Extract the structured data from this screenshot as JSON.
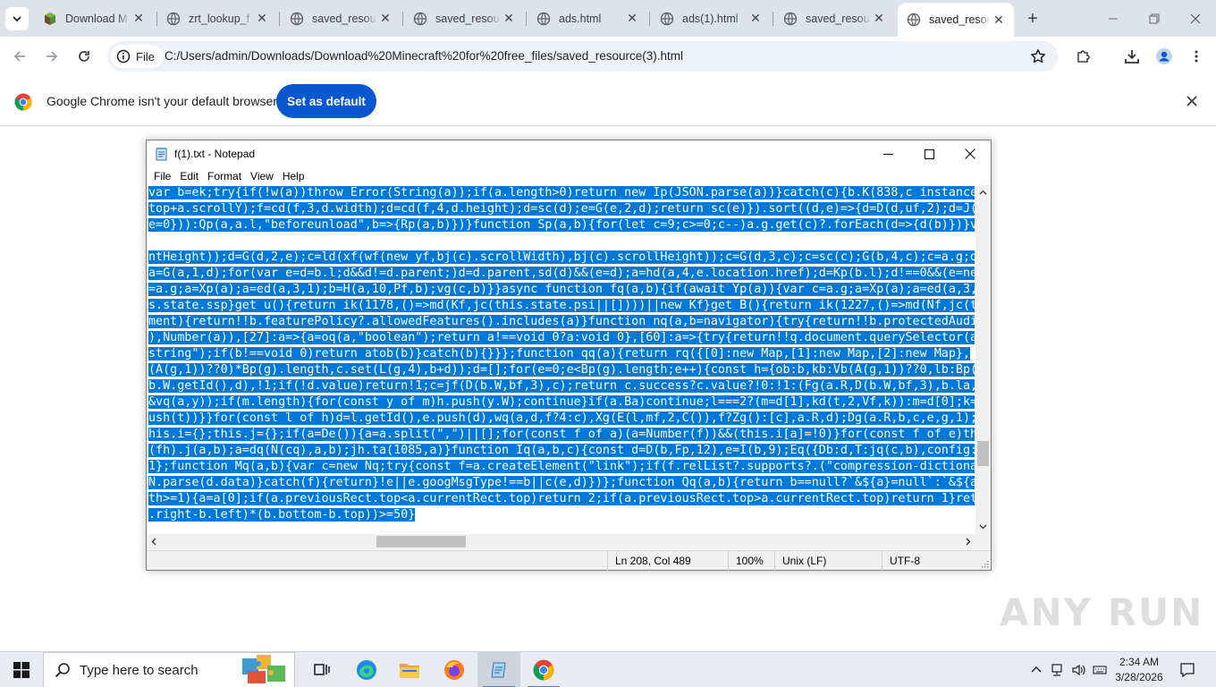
{
  "browser": {
    "tabs": [
      {
        "title": "Download M",
        "favicon": "minecraft-cube-icon"
      },
      {
        "title": "zrt_lookup_f",
        "favicon": "globe-icon"
      },
      {
        "title": "saved_resou",
        "favicon": "globe-icon"
      },
      {
        "title": "saved_resou",
        "favicon": "globe-icon"
      },
      {
        "title": "ads.html",
        "favicon": "globe-icon"
      },
      {
        "title": "ads(1).html",
        "favicon": "globe-icon"
      },
      {
        "title": "saved_resou",
        "favicon": "globe-icon"
      },
      {
        "title": "saved_resou",
        "favicon": "globe-icon",
        "active": true
      }
    ],
    "address": {
      "chip_label": "File",
      "url": "C:/Users/admin/Downloads/Download%20Minecraft%20for%20free_files/saved_resource(3).html"
    },
    "infobar": {
      "message": "Google Chrome isn't your default browser",
      "button_label": "Set as default"
    },
    "accent_color": "#0b57d0"
  },
  "notepad": {
    "title": "f(1).txt - Notepad",
    "menu": [
      "File",
      "Edit",
      "Format",
      "View",
      "Help"
    ],
    "lines": [
      "var b=ek;try{if(!w(a))throw Error(String(a));if(a.length>0)return new Ip(JSON.parse(a))}catch(c){b.K(838,c instance",
      "top+a.scrollY);f=cd(f,3,d.width);d=cd(f,4,d.height);d=sc(d);e=G(e,2,d);return sc(e)}).sort((d,e)=>{d=D(d,uf,2);d=J(",
      "e=0})):Qp(a,a.l,\"beforeunload\",b=>{Rp(a,b)})}function Sp(a,b){for(let c=9;c>=0;c--)a.g.get(c)?.forEach(d=>{d(b)})}v",
      "",
      "ntHeight));d=G(d,2,e);c=ld(xf(wf(new yf,bj(c).scrollWidth),bj(c).scrollHeight));c=G(d,3,c);c=sc(c);G(b,4,c);c=a.g;d",
      "a=G(a,1,d);for(var e=d=b.l;d&&d!=d.parent;)d=d.parent,sd(d)&&(e=d);a=hd(a,4,e.location.href);d=Kp(b.l);d!==0&&(e=ne",
      "=a.g;a=Xp(a);a=ed(a,3,1);b=H(a,10,Pf,b);vg(c,b)}}async function fq(a,b){if(await Yp(a)){var c=a.g;a=Xp(a);a=ed(a,3,",
      "s.state.ssp}get u(){return ik(1178,()=>md(Kf,jc(this.state.psi||[])))||new Kf}get B(){return ik(1227,()=>md(Nf,jc(t",
      "ment){return!!b.featurePolicy?.allowedFeatures().includes(a)}function nq(a,b=navigator){try{return!!b.protectedAudi",
      "),Number(a)),[27]:a=>{a=oq(a,\"boolean\");return a!==void 0?a:void 0},[60]:a=>{try{return!!q.document.querySelector(a",
      "string\");if(b!==void 0)return atob(b)}catch(b){}}};function qq(a){return rq({[0]:new Map,[1]:new Map,[2]:new Map},",
      "(A(g,1))??0)*Bp(g).length,c.set(L(g,4),b+d));d=[];for(e=0;e<Bp(g).length;e++){const h={ob:b,kb:Vb(A(g,1))??0,lb:Bp(",
      "b.W.getId(),d),!1;if(!d.value)return!1;c=jf(D(b.W,bf,3),c);return c.success?c.value?!0:!1:(Fg(a.R,D(b.W,bf,3),b.la,",
      "&vq(a,y));if(m.length){for(const y of m)h.push(y.W);continue}if(a.Ba)continue;l===2?(m=d[1],kd(t,2,Vf,k)):m=d[0];k=",
      "ush(t))}}for(const l of h)d=l.getId(),e.push(d),wq(a,d,f?4:c),Xg(E(l,mf,2,C()),f?Zg():[c],a.R,d);Dg(a.R,b,c,e,g,1);",
      "his.i={};this.j={};if(a=De()){a=a.split(\",\")||[];for(const f of a)(a=Number(f))&&(this.i[a]=!0)}for(const f of e)th",
      "(fh).j(a,b);a=dq(N(cq),a,b);jh.ta(1085,a)}function Iq(a,b,c){const d=D(b,Fp,12),e=I(b,9);Eq({Db:d,T:jq(c,b),config:",
      "1};function Mq(a,b){var c=new Nq;try{const f=a.createElement(\"link\");if(f.relList?.supports?.(\"compression-dictiona",
      "N.parse(d.data)}catch(f){return}!e||e.googMsgType!==b||c(e,d)})};function Qq(a,b){return b==null?`&${a}=null`:`&${a",
      "th>=1){a=a[0];if(a.previousRect.top<a.currentRect.top)return 2;if(a.previousRect.top>a.currentRect.top)return 1}ret",
      ".right-b.left)*(b.bottom-b.top))>=50}"
    ],
    "status": {
      "position": "Ln 208, Col 489",
      "zoom": "100%",
      "line_ending": "Unix (LF)",
      "encoding": "UTF-8"
    },
    "selection_color": "#0078d7"
  },
  "watermark": {
    "text": "ANY RUN"
  },
  "taskbar": {
    "search_placeholder": "Type here to search",
    "clock_time": "2:34 AM",
    "clock_date": "3/28/2026"
  }
}
